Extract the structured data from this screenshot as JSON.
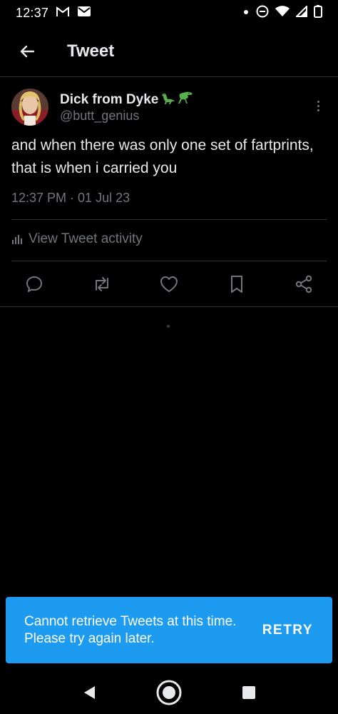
{
  "status_bar": {
    "time": "12:37",
    "left_icons": [
      "gmail-icon",
      "mail-icon"
    ],
    "right_icons": [
      "dot-icon",
      "do-not-disturb-icon",
      "wifi-icon",
      "signal-icon",
      "battery-icon"
    ]
  },
  "header": {
    "back_icon": "arrow-left-icon",
    "title": "Tweet"
  },
  "tweet": {
    "author_name": "Dick from Dyke",
    "author_emoji": [
      "dinosaur-icon",
      "t-rex-icon"
    ],
    "author_handle": "@butt_genius",
    "text": "and when there was only one set of fartprints, that is when i carried you",
    "timestamp": "12:37 PM · 01 Jul 23",
    "activity_label": "View Tweet activity",
    "actions": [
      "reply-icon",
      "retweet-icon",
      "like-icon",
      "bookmark-icon",
      "share-icon"
    ]
  },
  "snackbar": {
    "message": "Cannot retrieve Tweets at this time. Please try again later.",
    "action_label": "RETRY"
  },
  "nav_bar": {
    "buttons": [
      "back-triangle-icon",
      "home-circle-icon",
      "recents-square-icon"
    ]
  },
  "colors": {
    "background": "#000000",
    "primary_text": "#e7e9ea",
    "secondary_text": "#71767b",
    "divider": "#2f3336",
    "accent": "#1d9bf0"
  }
}
